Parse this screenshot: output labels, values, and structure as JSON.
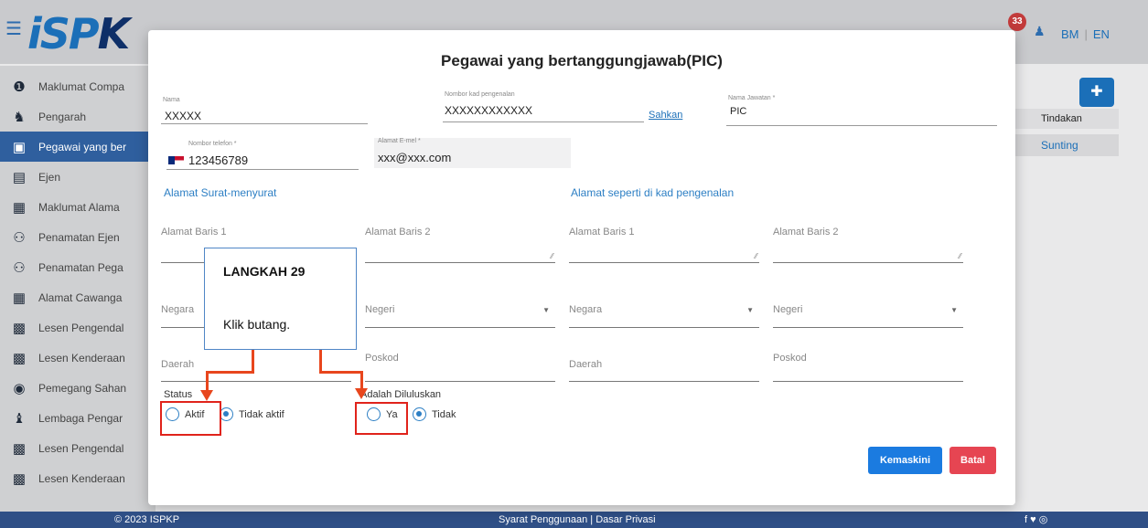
{
  "app": {
    "logo_text": "iSPKP",
    "notifications": "33",
    "lang_bm": "BM",
    "lang_sep": "|",
    "lang_en": "EN"
  },
  "sidebar": {
    "items": [
      {
        "label": "Maklumat Compa",
        "icon": "info-icon"
      },
      {
        "label": "Pengarah",
        "icon": "user-tie-icon"
      },
      {
        "label": "Pegawai yang ber",
        "icon": "id-badge-icon"
      },
      {
        "label": "Ejen",
        "icon": "contact-card-icon"
      },
      {
        "label": "Maklumat Alama",
        "icon": "address-book-icon"
      },
      {
        "label": "Penamatan Ejen",
        "icon": "users-icon"
      },
      {
        "label": "Penamatan Pega",
        "icon": "users-icon"
      },
      {
        "label": "Alamat Cawanga",
        "icon": "address-book-icon"
      },
      {
        "label": "Lesen Pengendal",
        "icon": "briefcase-icon"
      },
      {
        "label": "Lesen Kenderaan",
        "icon": "briefcase-icon"
      },
      {
        "label": "Pemegang Sahan",
        "icon": "user-circle-icon"
      },
      {
        "label": "Lembaga Pengar",
        "icon": "user-group-icon"
      },
      {
        "label": "Lesen Pengendal",
        "icon": "briefcase-icon"
      },
      {
        "label": "Lesen Kenderaan",
        "icon": "briefcase-icon"
      }
    ]
  },
  "right_panel": {
    "col_header": "Tindakan",
    "action_link": "Sunting"
  },
  "footer": {
    "copyright": "© 2023 ISPKP",
    "links": "Syarat Penggunaan | Dasar Privasi",
    "social": "f ♥ ◎"
  },
  "modal": {
    "title": "Pegawai yang bertanggungjawab(PIC)",
    "fields": {
      "nama_label": "Nama",
      "nama_value": "XXXXX",
      "ic_label": "Nombor kad pengenalan",
      "ic_value": "XXXXXXXXXXXX",
      "sahkan": "Sahkan",
      "jawatan_label": "Nama Jawatan *",
      "jawatan_value": "PIC",
      "phone_label": "Nombor telefon *",
      "phone_value": "123456789",
      "email_label": "Alamat E-mel *",
      "email_value": "xxx@xxx.com"
    },
    "sections": {
      "left": "Alamat Surat-menyurat",
      "right": "Alamat seperti di kad pengenalan"
    },
    "address_fields": {
      "line1": "Alamat Baris 1",
      "line2": "Alamat Baris 2",
      "negara": "Negara",
      "negeri": "Negeri",
      "daerah": "Daerah",
      "poskod": "Poskod"
    },
    "status": {
      "label": "Status",
      "opt_active": "Aktif",
      "opt_inactive": "Tidak aktif"
    },
    "approved": {
      "label": "Adalah Diluluskan",
      "opt_yes": "Ya",
      "opt_no": "Tidak"
    },
    "buttons": {
      "update": "Kemaskini",
      "cancel": "Batal"
    }
  },
  "callout": {
    "step": "LANGKAH 29",
    "instruction": "Klik butang."
  },
  "colors": {
    "primary": "#1b7be0",
    "danger": "#e64552",
    "annotation": "#e8461d"
  }
}
